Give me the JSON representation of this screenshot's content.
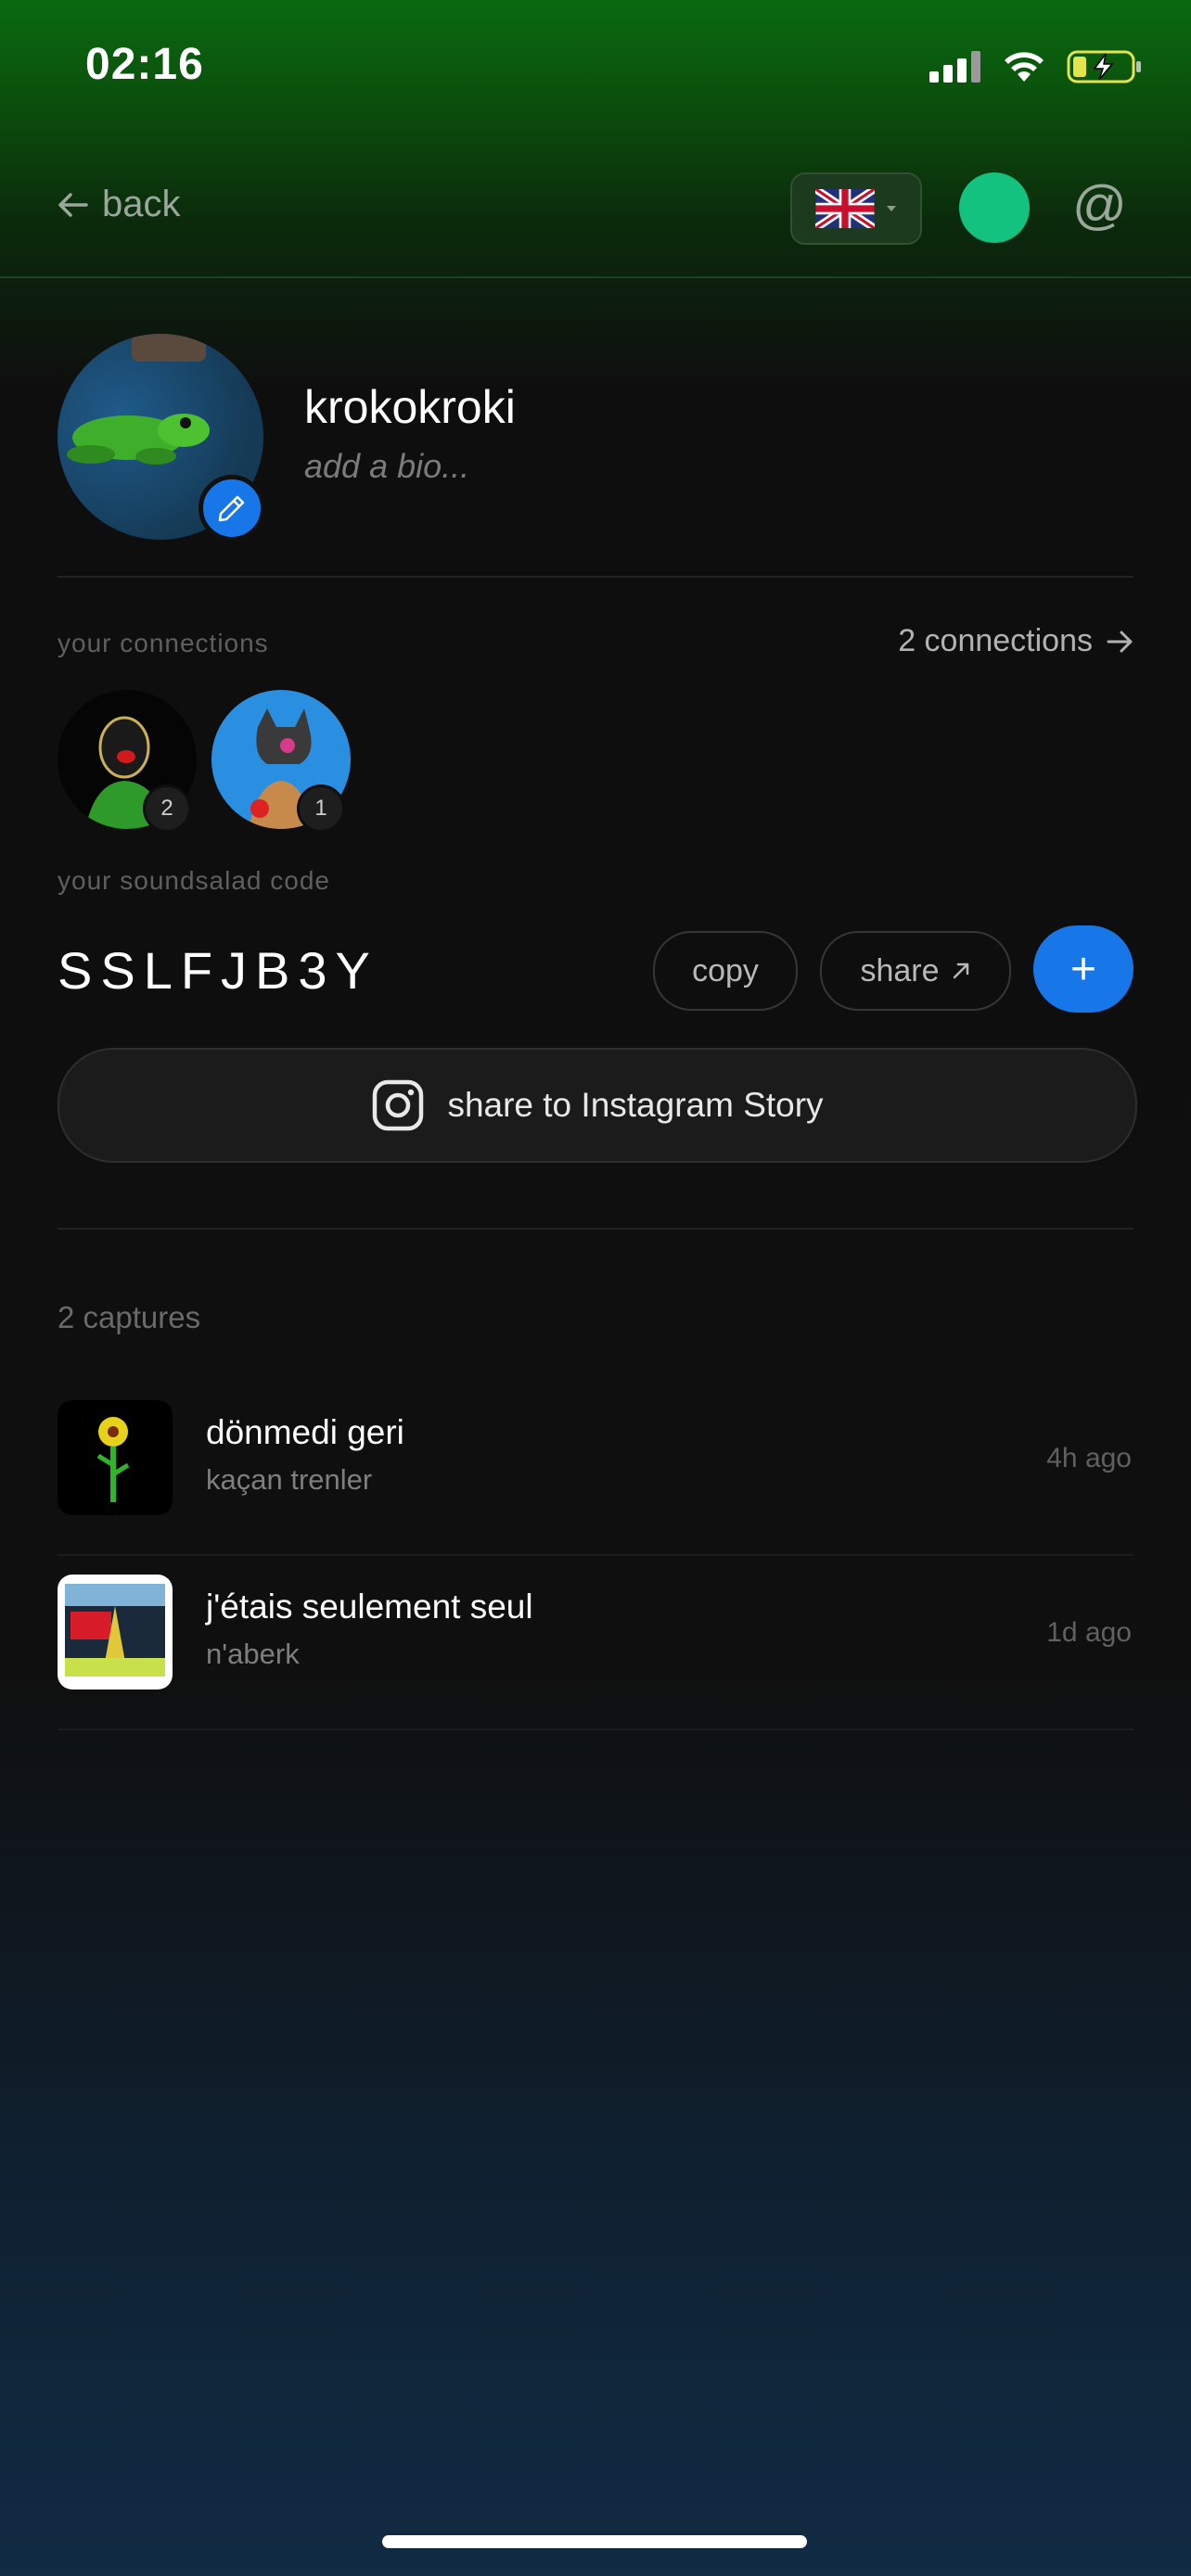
{
  "status_bar": {
    "time": "02:16"
  },
  "header": {
    "back_label": "back"
  },
  "profile": {
    "username": "krokokroki",
    "bio_placeholder": "add a bio..."
  },
  "connections": {
    "label": "your connections",
    "link_label": "2 connections",
    "items": [
      {
        "count": "2"
      },
      {
        "count": "1"
      }
    ]
  },
  "code_section": {
    "label": "your soundsalad code",
    "code": "SSLFJB3Y",
    "copy_label": "copy",
    "share_label": "share",
    "add_label": "+"
  },
  "instagram": {
    "label": "share to Instagram Story"
  },
  "captures": {
    "label": "2 captures",
    "items": [
      {
        "title": "dönmedi geri",
        "artist": "kaçan trenler",
        "time": "4h ago"
      },
      {
        "title": "j'étais seulement seul",
        "artist": "n'aberk",
        "time": "1d ago"
      }
    ]
  },
  "colors": {
    "accent_blue": "#1877e8",
    "status_green": "#12c27e",
    "header_green": "#0a6a10"
  }
}
